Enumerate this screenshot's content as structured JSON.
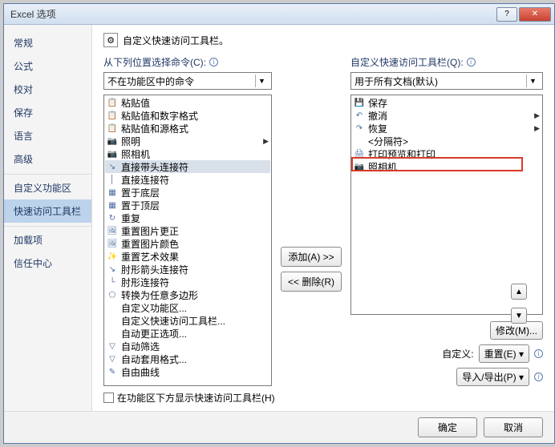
{
  "window": {
    "title": "Excel 选项",
    "help": "?",
    "close": "✕"
  },
  "sidebar": {
    "items": [
      {
        "label": "常规"
      },
      {
        "label": "公式"
      },
      {
        "label": "校对"
      },
      {
        "label": "保存"
      },
      {
        "label": "语言"
      },
      {
        "label": "高级"
      },
      {
        "label": "自定义功能区"
      },
      {
        "label": "快速访问工具栏"
      },
      {
        "label": "加载项"
      },
      {
        "label": "信任中心"
      }
    ],
    "selected_index": 7
  },
  "header": {
    "text": "自定义快速访问工具栏。"
  },
  "left": {
    "label": "从下列位置选择命令(C):",
    "combo": "不在功能区中的命令",
    "items": [
      {
        "icon": "📋",
        "label": "粘贴值"
      },
      {
        "icon": "📋",
        "label": "粘贴值和数字格式"
      },
      {
        "icon": "📋",
        "label": "粘贴值和源格式"
      },
      {
        "icon": "📷",
        "label": "照明",
        "submenu": true
      },
      {
        "icon": "📷",
        "label": "照相机"
      },
      {
        "icon": "↘",
        "label": "直接带头连接符",
        "selected": true
      },
      {
        "icon": "│",
        "label": "直接连接符"
      },
      {
        "icon": "▦",
        "label": "置于底层"
      },
      {
        "icon": "▦",
        "label": "置于顶层"
      },
      {
        "icon": "↻",
        "label": "重复"
      },
      {
        "icon": "🖼",
        "label": "重置图片更正"
      },
      {
        "icon": "🖼",
        "label": "重置图片颜色"
      },
      {
        "icon": "✨",
        "label": "重置艺术效果"
      },
      {
        "icon": "↘",
        "label": "肘形箭头连接符"
      },
      {
        "icon": "└",
        "label": "肘形连接符"
      },
      {
        "icon": "⬠",
        "label": "转换为任意多边形"
      },
      {
        "icon": "",
        "label": "自定义功能区..."
      },
      {
        "icon": "",
        "label": "自定义快速访问工具栏..."
      },
      {
        "icon": "",
        "label": "自动更正选项..."
      },
      {
        "icon": "▽",
        "label": "自动筛选"
      },
      {
        "icon": "▽",
        "label": "自动套用格式..."
      },
      {
        "icon": "✎",
        "label": "自由曲线"
      }
    ]
  },
  "right": {
    "label": "自定义快速访问工具栏(Q):",
    "combo": "用于所有文档(默认)",
    "items": [
      {
        "icon": "💾",
        "label": "保存"
      },
      {
        "icon": "↶",
        "label": "撤消",
        "submenu": true
      },
      {
        "icon": "↷",
        "label": "恢复",
        "submenu": true
      },
      {
        "icon": "",
        "label": "<分隔符>"
      },
      {
        "icon": "🖨",
        "label": "打印预览和打印"
      },
      {
        "icon": "📷",
        "label": "照相机"
      }
    ]
  },
  "mid": {
    "add": "添加(A) >>",
    "remove": "<< 删除(R)"
  },
  "below": {
    "modify": "修改(M)...",
    "customize_label": "自定义:",
    "reset": "重置(E)",
    "import_export": "导入/导出(P)"
  },
  "checkbox_label": "在功能区下方显示快速访问工具栏(H)",
  "footer": {
    "ok": "确定",
    "cancel": "取消"
  }
}
